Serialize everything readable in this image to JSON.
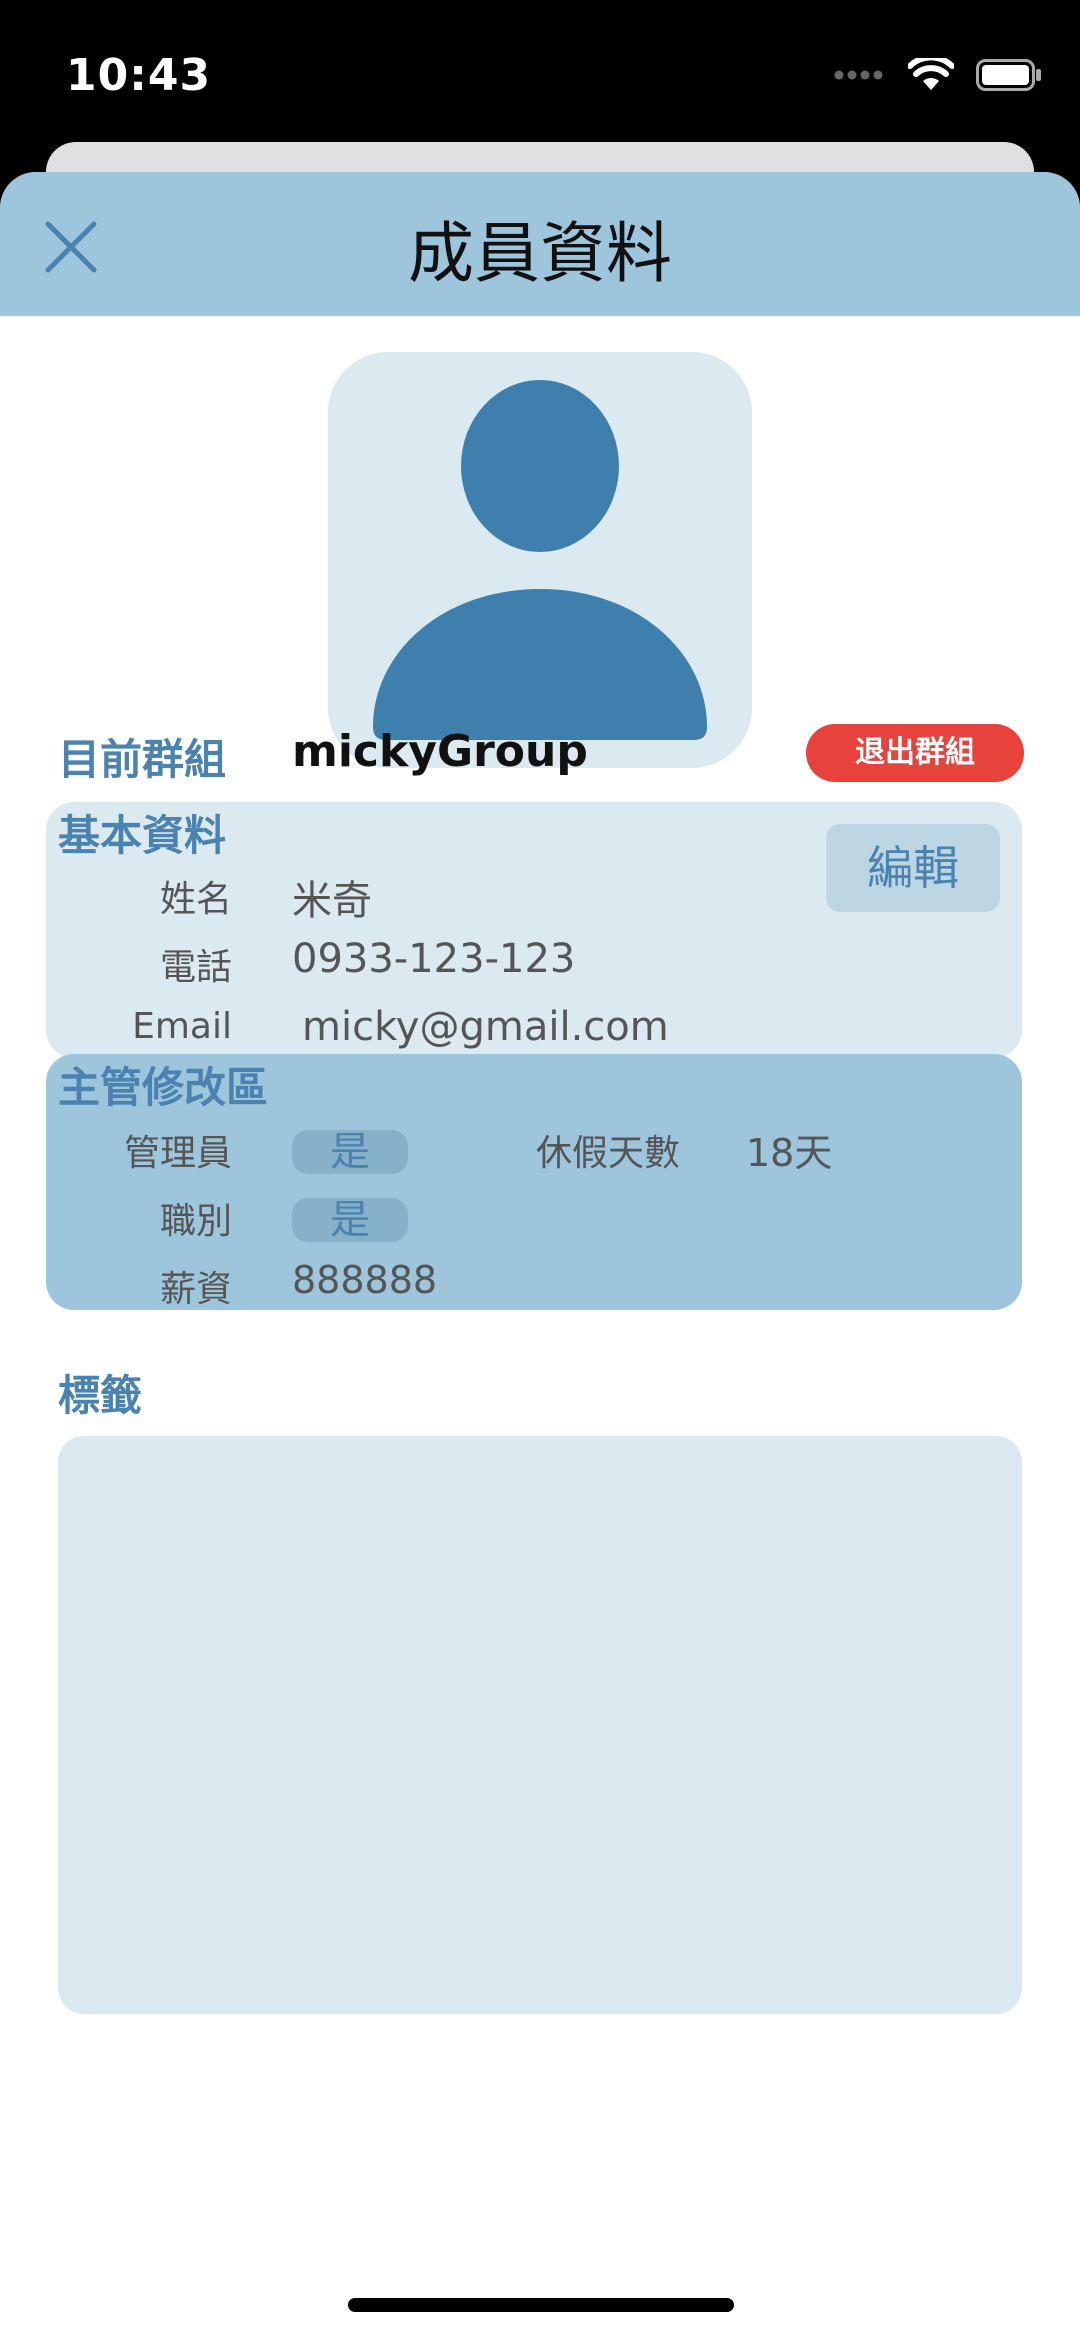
{
  "status_bar": {
    "time": "10:43"
  },
  "nav": {
    "title": "成員資料",
    "close_icon": "close-icon"
  },
  "group": {
    "label": "目前群組",
    "value": "mickyGroup",
    "leave_button": "退出群組"
  },
  "basic_info": {
    "title": "基本資料",
    "edit_button": "編輯",
    "fields": [
      {
        "label": "姓名",
        "value": "米奇"
      },
      {
        "label": "電話",
        "value": "0933-123-123"
      },
      {
        "label": "Email",
        "value": "micky@gmail.com"
      }
    ]
  },
  "manager_area": {
    "title": "主管修改區",
    "admin_label": "管理員",
    "admin_value": "是",
    "position_label": "職別",
    "position_value": "是",
    "salary_label": "薪資",
    "salary_value": "888888",
    "leave_days_label": "休假天數",
    "leave_days_value": "18天"
  },
  "tags": {
    "title": "標籤"
  },
  "colors": {
    "nav_bg": "#9dc5dc",
    "panel_light": "#dbeaf0",
    "accent_text": "#4a82b0",
    "avatar": "#3f7fad",
    "danger": "#e8423d"
  }
}
